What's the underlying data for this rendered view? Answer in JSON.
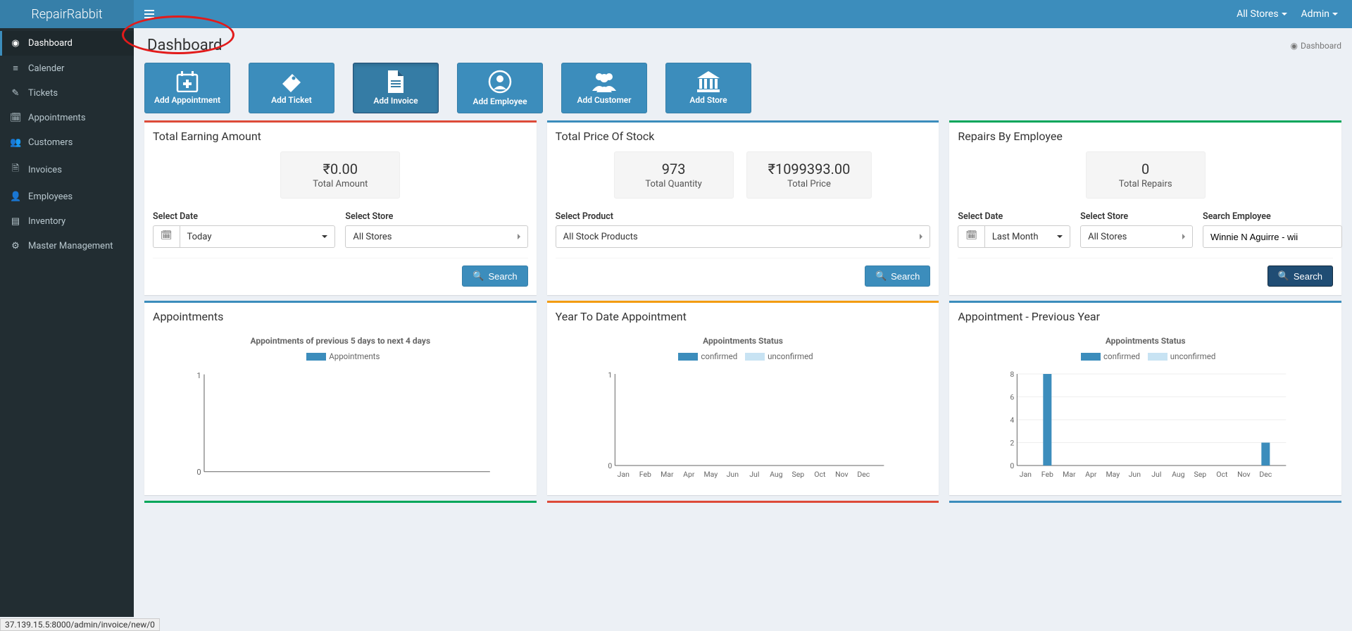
{
  "brand": "RepairRabbit",
  "topbar": {
    "stores": "All Stores",
    "user": "Admin"
  },
  "sidebar": {
    "items": [
      {
        "label": "Dashboard",
        "icon": "dashboard"
      },
      {
        "label": "Calender",
        "icon": "list"
      },
      {
        "label": "Tickets",
        "icon": "tag"
      },
      {
        "label": "Appointments",
        "icon": "calendar"
      },
      {
        "label": "Customers",
        "icon": "users"
      },
      {
        "label": "Invoices",
        "icon": "file"
      },
      {
        "label": "Employees",
        "icon": "user"
      },
      {
        "label": "Inventory",
        "icon": "inventory"
      },
      {
        "label": "Master Management",
        "icon": "gears"
      }
    ]
  },
  "page": {
    "title": "Dashboard",
    "breadcrumb": "Dashboard"
  },
  "actions": [
    {
      "label": "Add Appointment",
      "icon": "calendar-plus"
    },
    {
      "label": "Add Ticket",
      "icon": "ticket"
    },
    {
      "label": "Add Invoice",
      "icon": "file"
    },
    {
      "label": "Add Employee",
      "icon": "user-circle"
    },
    {
      "label": "Add Customer",
      "icon": "users"
    },
    {
      "label": "Add Store",
      "icon": "store"
    }
  ],
  "earning": {
    "title": "Total Earning Amount",
    "value": "₹0.00",
    "label": "Total Amount",
    "select_date_label": "Select Date",
    "date_value": "Today",
    "select_store_label": "Select Store",
    "store_value": "All Stores",
    "search": "Search"
  },
  "stock": {
    "title": "Total Price Of Stock",
    "qty_value": "973",
    "qty_label": "Total Quantity",
    "price_value": "₹1099393.00",
    "price_label": "Total Price",
    "select_product_label": "Select Product",
    "product_value": "All Stock Products",
    "search": "Search"
  },
  "repairs": {
    "title": "Repairs By Employee",
    "value": "0",
    "label": "Total Repairs",
    "select_date_label": "Select Date",
    "date_value": "Last Month",
    "select_store_label": "Select Store",
    "store_value": "All Stores",
    "search_emp_label": "Search Employee",
    "emp_value": "Winnie N Aguirre - wii",
    "search": "Search"
  },
  "charts": {
    "appts": {
      "title": "Appointments",
      "subtitle": "Appointments of previous 5 days to next 4 days",
      "legend": [
        "Appointments"
      ]
    },
    "ytd": {
      "title": "Year To Date Appointment",
      "subtitle": "Appointments Status",
      "legend": [
        "confirmed",
        "unconfirmed"
      ]
    },
    "prev": {
      "title": "Appointment - Previous Year",
      "subtitle": "Appointments Status",
      "legend": [
        "confirmed",
        "unconfirmed"
      ]
    }
  },
  "chart_data": [
    {
      "id": "appointments_window",
      "type": "bar",
      "title": "Appointments of previous 5 days to next 4 days",
      "series": [
        {
          "name": "Appointments",
          "values": []
        }
      ],
      "categories": [],
      "ylim": [
        0,
        1
      ]
    },
    {
      "id": "ytd_appointments",
      "type": "bar",
      "title": "Appointments Status",
      "categories": [
        "Jan",
        "Feb",
        "Mar",
        "Apr",
        "May",
        "Jun",
        "Jul",
        "Aug",
        "Sep",
        "Oct",
        "Nov",
        "Dec"
      ],
      "series": [
        {
          "name": "confirmed",
          "values": [
            0,
            0,
            0,
            0,
            0,
            0,
            0,
            0,
            0,
            0,
            0,
            0
          ]
        },
        {
          "name": "unconfirmed",
          "values": [
            0,
            0,
            0,
            0,
            0,
            0,
            0,
            0,
            0,
            0,
            0,
            0
          ]
        }
      ],
      "ylim": [
        0,
        1
      ]
    },
    {
      "id": "prev_year_appointments",
      "type": "bar",
      "title": "Appointments Status",
      "categories": [
        "Jan",
        "Feb",
        "Mar",
        "Apr",
        "May",
        "Jun",
        "Jul",
        "Aug",
        "Sep",
        "Oct",
        "Nov",
        "Dec"
      ],
      "series": [
        {
          "name": "confirmed",
          "values": [
            0,
            8,
            0,
            0,
            0,
            0,
            0,
            0,
            0,
            0,
            0,
            2
          ]
        },
        {
          "name": "unconfirmed",
          "values": [
            0,
            0,
            0,
            0,
            0,
            0,
            0,
            0,
            0,
            0,
            0,
            0
          ]
        }
      ],
      "ylim": [
        0,
        8
      ]
    }
  ],
  "statusbar": "37.139.15.5:8000/admin/invoice/new/0"
}
